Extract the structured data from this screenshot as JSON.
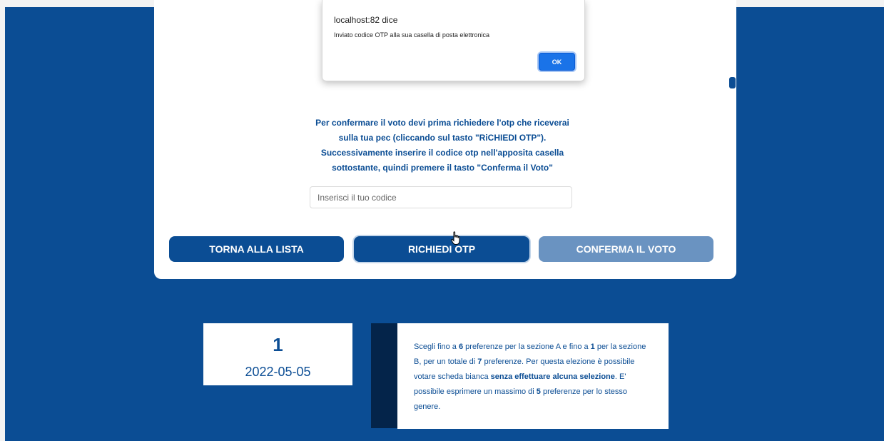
{
  "dialog": {
    "title": "localhost:82 dice",
    "message": "Inviato codice OTP alla sua casella di posta elettronica",
    "ok_label": "OK"
  },
  "instructions": {
    "lines": [
      "Per confermare il voto devi prima richiedere l'otp che riceverai",
      "sulla tua pec (cliccando sul tasto \"RiCHIEDI OTP\").",
      "Successivamente inserire il codice otp nell'apposita casella",
      "sottostante, quindi premere il tasto \"Conferma il Voto\""
    ]
  },
  "otp_input": {
    "placeholder": "Inserisci il tuo codice",
    "value": ""
  },
  "buttons": {
    "back": "TORNA ALLA LISTA",
    "request_otp": "RICHIEDI OTP",
    "confirm": "CONFERMA IL VOTO"
  },
  "counter": {
    "number": "1",
    "date": "2022-05-05"
  },
  "info": {
    "p1": "Scegli fino a ",
    "n1": "6",
    "p2": " preferenze per la sezione A e fino a ",
    "n2": "1",
    "p3": " per la sezione B, per un totale di ",
    "n3": "7",
    "p4": " preferenze. Per questa elezione è possibile votare scheda bianca ",
    "b1": "senza effettuare alcuna selezione",
    "p5": ". E' possibile esprimere un massimo di ",
    "n4": "5",
    "p6": " preferenze per lo stesso genere."
  },
  "colors": {
    "primary": "#0b4d94",
    "primary_disabled": "#6a93c1",
    "dark_stripe": "#04244a",
    "dialog_button": "#1a73e8"
  }
}
